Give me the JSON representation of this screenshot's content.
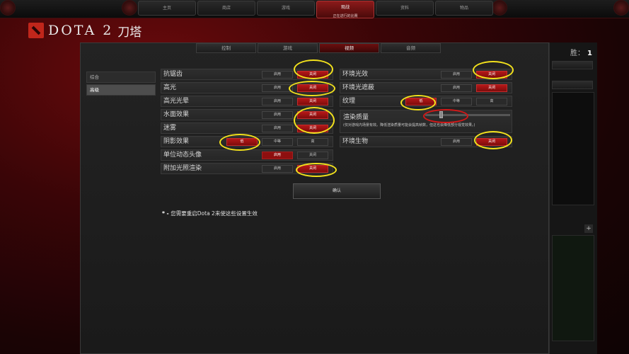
{
  "nav": {
    "tabs": [
      "主页",
      "商店",
      "游戏",
      "观战",
      "资料",
      "物品"
    ],
    "active_sub": "正在进行的比赛"
  },
  "logo": {
    "text": "DOTA 2",
    "cn": "刀塔"
  },
  "score": {
    "label": "胜：",
    "value": "1"
  },
  "settings": {
    "tabs": [
      "控制",
      "游戏",
      "视频",
      "音频"
    ],
    "active_tab": "视频",
    "sidebar": [
      "综合",
      "高级"
    ],
    "active_sidebar": "高级",
    "left_rows": [
      {
        "label": "抗锯齿",
        "options": [
          "启用",
          "关闭"
        ],
        "selected": "关闭"
      },
      {
        "label": "高光",
        "options": [
          "启用",
          "关闭"
        ],
        "selected": "关闭"
      },
      {
        "label": "高光光晕",
        "options": [
          "启用",
          "关闭"
        ],
        "selected": "关闭"
      },
      {
        "label": "水面效果",
        "options": [
          "启用",
          "关闭"
        ],
        "selected": "关闭"
      },
      {
        "label": "迷雾",
        "options": [
          "启用",
          "关闭"
        ],
        "selected": "关闭"
      },
      {
        "label": "阴影效果",
        "options": [
          "低",
          "中等",
          "高"
        ],
        "selected": "低"
      },
      {
        "label": "单位动态头像",
        "options": [
          "启用",
          "关闭"
        ],
        "selected": "启用"
      },
      {
        "label": "附加光照渲染",
        "options": [
          "启用",
          "关闭"
        ],
        "selected": "关闭"
      }
    ],
    "right_rows": [
      {
        "label": "环境光效",
        "options": [
          "启用",
          "关闭"
        ],
        "selected": "关闭"
      },
      {
        "label": "环境光遮蔽",
        "options": [
          "启用",
          "关闭"
        ],
        "selected": "关闭"
      },
      {
        "label": "纹理",
        "options": [
          "低",
          "中等",
          "高"
        ],
        "selected": "低"
      }
    ],
    "render_quality": {
      "label": "渲染质量",
      "note": "(仅对游戏内场景有效。降低渲染质量可能会提高帧数，但这也会降低部分视觉效果。)",
      "value_percent": 20
    },
    "ambient_creatures": {
      "label": "环境生物",
      "options": [
        "启用",
        "关闭"
      ],
      "selected": "关闭"
    },
    "confirm_label": "确认",
    "restart_note_prefix": "* - ",
    "restart_note": "您需要重启Dota 2来使这些设置生效"
  },
  "colors": {
    "selected_option": "#b51818",
    "annotation": "#f2e11c",
    "annotation_red": "#d11818"
  }
}
